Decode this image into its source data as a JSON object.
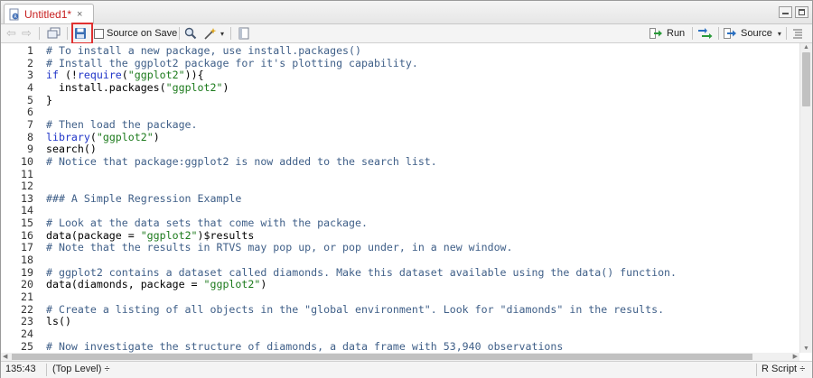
{
  "tab": {
    "title": "Untitled1*",
    "close_glyph": "×"
  },
  "toolbar": {
    "source_on_save_label": "Source on Save",
    "run_label": "Run",
    "source_label": "Source"
  },
  "editor": {
    "lines": [
      {
        "n": "1",
        "segs": [
          {
            "t": "# To install a new package, use install.packages()",
            "c": "comment"
          }
        ]
      },
      {
        "n": "2",
        "segs": [
          {
            "t": "# Install the ggplot2 package for it's plotting capability.",
            "c": "comment"
          }
        ]
      },
      {
        "n": "3",
        "segs": [
          {
            "t": "if",
            "c": "kw"
          },
          {
            "t": " (!",
            "c": "plain"
          },
          {
            "t": "require",
            "c": "kw"
          },
          {
            "t": "(",
            "c": "plain"
          },
          {
            "t": "\"ggplot2\"",
            "c": "str"
          },
          {
            "t": ")){",
            "c": "plain"
          }
        ]
      },
      {
        "n": "4",
        "segs": [
          {
            "t": "  install.packages(",
            "c": "plain"
          },
          {
            "t": "\"ggplot2\"",
            "c": "str"
          },
          {
            "t": ")",
            "c": "plain"
          }
        ]
      },
      {
        "n": "5",
        "segs": [
          {
            "t": "}",
            "c": "plain"
          }
        ]
      },
      {
        "n": "6",
        "segs": []
      },
      {
        "n": "7",
        "segs": [
          {
            "t": "# Then load the package.",
            "c": "comment"
          }
        ]
      },
      {
        "n": "8",
        "segs": [
          {
            "t": "library",
            "c": "kw"
          },
          {
            "t": "(",
            "c": "plain"
          },
          {
            "t": "\"ggplot2\"",
            "c": "str"
          },
          {
            "t": ")",
            "c": "plain"
          }
        ]
      },
      {
        "n": "9",
        "segs": [
          {
            "t": "search()",
            "c": "plain"
          }
        ]
      },
      {
        "n": "10",
        "segs": [
          {
            "t": "# Notice that package:ggplot2 is now added to the search list.",
            "c": "comment"
          }
        ]
      },
      {
        "n": "11",
        "segs": []
      },
      {
        "n": "12",
        "segs": []
      },
      {
        "n": "13",
        "segs": [
          {
            "t": "### A Simple Regression Example",
            "c": "comment"
          }
        ]
      },
      {
        "n": "14",
        "segs": []
      },
      {
        "n": "15",
        "segs": [
          {
            "t": "# Look at the data sets that come with the package.",
            "c": "comment"
          }
        ]
      },
      {
        "n": "16",
        "segs": [
          {
            "t": "data(package = ",
            "c": "plain"
          },
          {
            "t": "\"ggplot2\"",
            "c": "str"
          },
          {
            "t": ")$results",
            "c": "plain"
          }
        ]
      },
      {
        "n": "17",
        "segs": [
          {
            "t": "# Note that the results in RTVS may pop up, or pop under, in a new window.",
            "c": "comment"
          }
        ]
      },
      {
        "n": "18",
        "segs": []
      },
      {
        "n": "19",
        "segs": [
          {
            "t": "# ggplot2 contains a dataset called diamonds. Make this dataset available using the data() function.",
            "c": "comment"
          }
        ]
      },
      {
        "n": "20",
        "segs": [
          {
            "t": "data(diamonds, package = ",
            "c": "plain"
          },
          {
            "t": "\"ggplot2\"",
            "c": "str"
          },
          {
            "t": ")",
            "c": "plain"
          }
        ]
      },
      {
        "n": "21",
        "segs": []
      },
      {
        "n": "22",
        "segs": [
          {
            "t": "# Create a listing of all objects in the \"global environment\". Look for \"diamonds\" in the results.",
            "c": "comment"
          }
        ]
      },
      {
        "n": "23",
        "segs": [
          {
            "t": "ls()",
            "c": "plain"
          }
        ]
      },
      {
        "n": "24",
        "segs": []
      },
      {
        "n": "25",
        "segs": [
          {
            "t": "# Now investigate the structure of diamonds, a data frame with 53,940 observations",
            "c": "comment"
          }
        ]
      }
    ]
  },
  "status": {
    "position": "135:43",
    "scope": "(Top Level)",
    "scope_caret": "÷",
    "filetype": "R Script",
    "filetype_caret": "÷"
  },
  "colors": {
    "comment": "#3f5f88",
    "keyword": "#2035c8",
    "string": "#1c7a1c",
    "highlight": "#e03131"
  },
  "icons": [
    "file-r-icon",
    "back-icon",
    "forward-icon",
    "show-in-window-icon",
    "save-icon",
    "search-icon",
    "magic-wand-icon",
    "compile-report-icon",
    "run-icon",
    "rerun-icon",
    "source-icon",
    "outline-icon"
  ]
}
